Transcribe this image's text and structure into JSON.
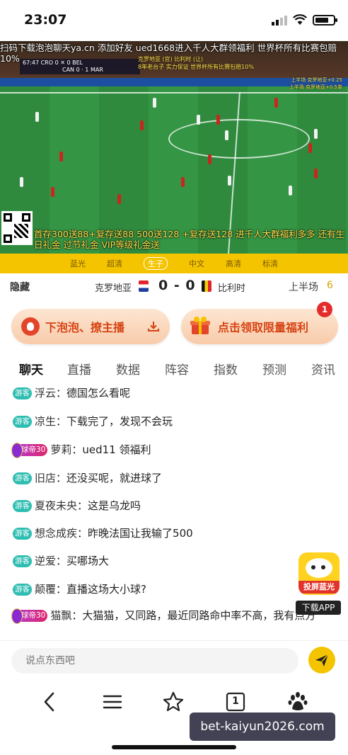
{
  "status_bar": {
    "time": "23:07"
  },
  "video": {
    "marquee": "扫码下载泡泡聊天ya.cn 添加好友 ued1668进入千人大群领福利 世界杯所有比赛包赔10%",
    "scorebug_line1": "67:47  CRO 0 ✕ 0 BEL",
    "scorebug_line2": "CAN 0 · 1 MAR",
    "promo_top_1": "克罗地亚 (官) 比利时 (让)",
    "promo_top_2": "8年老台子 实力保证 世界杯所有比赛包赔10%",
    "side_note_1": "上半场 克罗地亚+0.25",
    "side_note_2": "上半场 克罗地亚+0.5单",
    "promo_bottom": "首存300送88+复存送88 500送128 +复存送128 进千人大群福利多多 还有生日礼金 过节礼金 VIP等级礼金送"
  },
  "quality_tabs": [
    {
      "label": "蓝光",
      "active": false
    },
    {
      "label": "超清",
      "active": false
    },
    {
      "label": "生子",
      "active": true
    },
    {
      "label": "中文",
      "active": false
    },
    {
      "label": "高清",
      "active": false
    },
    {
      "label": "标清",
      "active": false
    }
  ],
  "score_row": {
    "hide_label": "隐藏",
    "home_team": "克罗地亚",
    "score": "0 - 0",
    "away_team": "比利时",
    "period": "上半场",
    "minute": "6"
  },
  "banners": {
    "left_label": "下泡泡、撩主播",
    "right_label": "点击领取限量福利",
    "badge_count": "1"
  },
  "tabs": [
    {
      "label": "聊天",
      "active": true
    },
    {
      "label": "直播",
      "active": false
    },
    {
      "label": "数据",
      "active": false
    },
    {
      "label": "阵容",
      "active": false
    },
    {
      "label": "指数",
      "active": false
    },
    {
      "label": "预测",
      "active": false
    },
    {
      "label": "资讯",
      "active": false
    }
  ],
  "chat": [
    {
      "tag": "游客",
      "name": "浮云",
      "text": "德国怎么看呢"
    },
    {
      "tag": "游客",
      "name": "凉生",
      "text": "下载完了，发现不会玩"
    },
    {
      "tag": "球帝30",
      "name": "萝莉",
      "text": "ued11 领福利"
    },
    {
      "tag": "游客",
      "name": "旧店",
      "text": "还没买呢，就进球了"
    },
    {
      "tag": "游客",
      "name": "夏夜未央",
      "text": "这是乌龙吗"
    },
    {
      "tag": "游客",
      "name": "想念成疾",
      "text": "昨晚法国让我输了500"
    },
    {
      "tag": "游客",
      "name": "逆爱",
      "text": "买哪场大"
    },
    {
      "tag": "游客",
      "name": "颠覆",
      "text": "直播这场大小球?"
    },
    {
      "tag": "球帝30",
      "name": "猫飘",
      "text": "大猫猫，又同路，最近同路命中率不高，我有点方"
    }
  ],
  "float_app": {
    "label": "投屏蓝光",
    "download": "下载APP"
  },
  "input": {
    "placeholder": "说点东西吧"
  },
  "browser_bar": {
    "tab_count": "1"
  },
  "watermark": "bet-kaiyun2026.com",
  "colors": {
    "accent": "#f5c400",
    "guest_tag": "#2dbdb1",
    "banner_text": "#d64313"
  }
}
